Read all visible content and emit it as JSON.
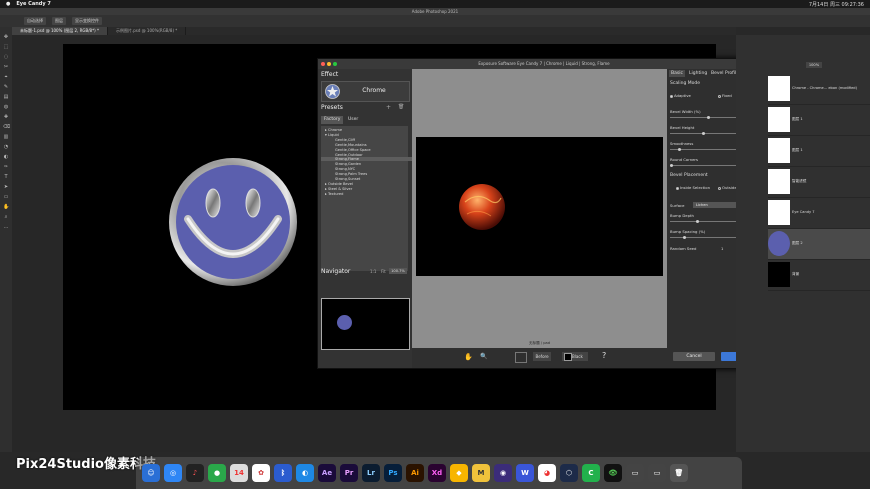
{
  "menubar": {
    "apple": "",
    "app_name": "Eye Candy 7",
    "status_time": "7月14日 周三 09:27:36"
  },
  "ps": {
    "window_title": "Adobe Photoshop 2021",
    "options": [
      "自动选择",
      "图层",
      "显示变换控件"
    ],
    "tabs": [
      {
        "label": "未标题-1.psd @ 100% (图层 2, RGB/8*) *"
      },
      {
        "label": "示例图片.psd @ 100%(RGB/8) *"
      }
    ]
  },
  "dialog": {
    "title": "Exposure Software Eye Candy 7 | Chrome | Liquid | Strong, Flame",
    "effect_label": "Effect",
    "effect_name": "Chrome",
    "presets_label": "Presets",
    "preset_tabs": [
      "Factory",
      "User"
    ],
    "presets": [
      {
        "label": "▸ Chrome",
        "indent": 0
      },
      {
        "label": "▾ Liquid",
        "indent": 0
      },
      {
        "label": "Gentle,Cliff",
        "indent": 1
      },
      {
        "label": "Gentle,Mountains",
        "indent": 1
      },
      {
        "label": "Gentle,Office Space",
        "indent": 1
      },
      {
        "label": "Gentle,Outdoor",
        "indent": 1
      },
      {
        "label": "Strong,Flame",
        "indent": 1,
        "selected": true
      },
      {
        "label": "Strong,Garden",
        "indent": 1
      },
      {
        "label": "Strong,NYC",
        "indent": 1
      },
      {
        "label": "Strong,Palm Trees",
        "indent": 1
      },
      {
        "label": "Strong,Sunset",
        "indent": 1
      },
      {
        "label": "▸ Outside Bevel",
        "indent": 0
      },
      {
        "label": "▸ Steel & Silver",
        "indent": 0
      },
      {
        "label": "▸ Textured",
        "indent": 0
      }
    ],
    "navigator_label": "Navigator",
    "nav_fit": "Fit",
    "nav_zoom": "100.7%",
    "preview_caption": "无标题 / pad",
    "bottom": {
      "before_label": "Before",
      "bg_label": "Black"
    },
    "right_tabs": [
      "Basic",
      "Lighting",
      "Bevel Profile"
    ],
    "scaling_mode_label": "Scaling Mode",
    "scaling_options": [
      "Adaptive",
      "Fixed"
    ],
    "sliders": [
      {
        "label": "Bevel Width (%)",
        "value": "50.00",
        "fraction": 0.58
      },
      {
        "label": "Bevel Height",
        "value": "50",
        "fraction": 0.5
      },
      {
        "label": "Smoothness",
        "value": "10.00",
        "fraction": 0.12
      },
      {
        "label": "Round Corners",
        "value": "0",
        "fraction": 0.0
      }
    ],
    "bevel_placement_label": "Bevel Placement",
    "placement_options": [
      "Inside Selection",
      "Outside Selection"
    ],
    "surface_label": "Surface",
    "surface_value": "Lichen",
    "bump_sliders": [
      {
        "label": "Bump Depth",
        "value": "40",
        "fraction": 0.4
      },
      {
        "label": "Bump Spacing (%)",
        "value": "20.00",
        "fraction": 0.2
      }
    ],
    "random_seed_label": "Random Seed",
    "random_seed_value": "1",
    "cancel_label": "Cancel",
    "ok_label": "OK"
  },
  "layers": [
    {
      "name": "Chrome - Chrome... ebon (modified)"
    },
    {
      "name": "图层 1"
    },
    {
      "name": "图层 1"
    },
    {
      "name": "智能滤镜"
    },
    {
      "name": "Eye Candy 7"
    },
    {
      "name": "图层 2"
    },
    {
      "name": "背景"
    }
  ],
  "layers_opacity": "100%",
  "dock_apps": [
    "Ae",
    "Pr",
    "Lr",
    "Ps",
    "Ai",
    "Xd",
    "M"
  ],
  "watermark": "Pix24Studio像素科技",
  "colors": {
    "smiley_fill": "#5b5fae",
    "ok_button": "#3c78d8",
    "fireball": "#d8431a"
  }
}
